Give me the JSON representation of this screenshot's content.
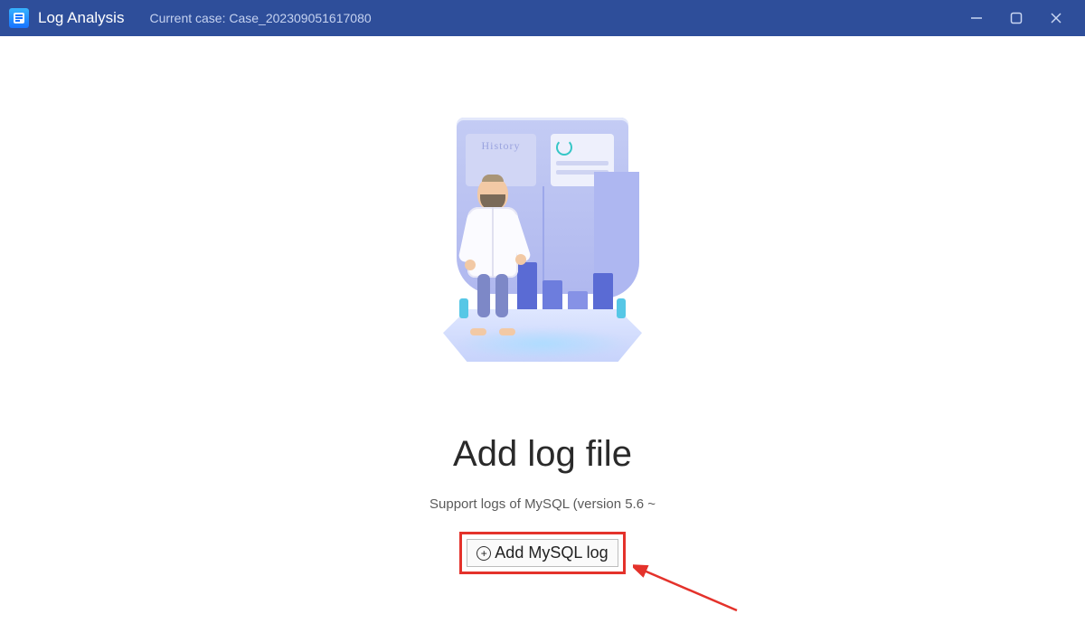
{
  "titlebar": {
    "app_title": "Log Analysis",
    "case_label": "Current case: Case_202309051617080"
  },
  "illustration": {
    "history_panel_text": "History"
  },
  "main": {
    "heading": "Add log file",
    "subtext": "Support logs of MySQL (version 5.6 ~",
    "add_button_label": "Add MySQL log"
  }
}
